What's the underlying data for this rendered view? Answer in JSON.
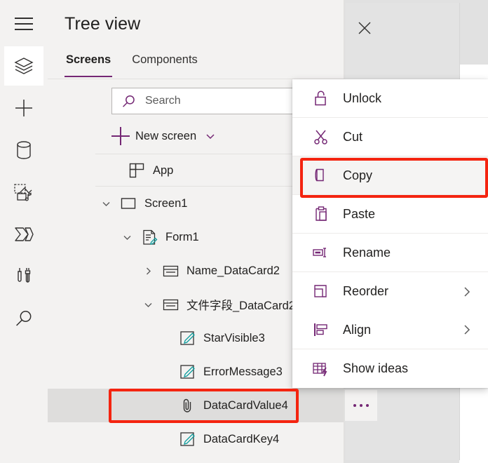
{
  "colors": {
    "accent_purple": "#742774",
    "annotation_red": "#f42410",
    "panel_bg": "#f3f2f1",
    "selected_row": "#dedddc",
    "canvas_bg": "#e1e1e1",
    "label_teal": "#0f9d9d"
  },
  "rail": {
    "items": [
      {
        "name": "hamburger-menu-icon",
        "selected": false
      },
      {
        "name": "tree-view-layers-icon",
        "selected": true
      },
      {
        "name": "insert-plus-icon",
        "selected": false
      },
      {
        "name": "data-cylinder-icon",
        "selected": false
      },
      {
        "name": "media-icon",
        "selected": false
      },
      {
        "name": "power-automate-icon",
        "selected": false
      },
      {
        "name": "variables-tools-icon",
        "selected": false
      },
      {
        "name": "search-rail-icon",
        "selected": false
      }
    ]
  },
  "panel": {
    "title": "Tree view",
    "close_label": "Close",
    "tabs": [
      {
        "label": "Screens",
        "active": true
      },
      {
        "label": "Components",
        "active": false
      }
    ],
    "search": {
      "placeholder": "Search",
      "value": ""
    },
    "new_screen": {
      "label": "New screen"
    },
    "tree": [
      {
        "label": "App",
        "indent": 0,
        "chevron": "none",
        "icon": "app-grid-icon",
        "selected": false
      },
      {
        "label": "Screen1",
        "indent": 0,
        "chevron": "down",
        "icon": "screen-rect-icon",
        "selected": false
      },
      {
        "label": "Form1",
        "indent": 1,
        "chevron": "down",
        "icon": "form-edit-icon",
        "selected": false
      },
      {
        "label": "Name_DataCard2",
        "indent": 2,
        "chevron": "right",
        "icon": "datacard-icon",
        "selected": false
      },
      {
        "label": "文件字段_DataCard2",
        "indent": 2,
        "chevron": "down",
        "icon": "datacard-icon",
        "selected": false
      },
      {
        "label": "StarVisible3",
        "indent": 3,
        "chevron": "none",
        "icon": "label-edit-icon",
        "selected": false
      },
      {
        "label": "ErrorMessage3",
        "indent": 3,
        "chevron": "none",
        "icon": "label-edit-icon",
        "selected": false
      },
      {
        "label": "DataCardValue4",
        "indent": 3,
        "chevron": "none",
        "icon": "attachment-paperclip-icon",
        "selected": true
      },
      {
        "label": "DataCardKey4",
        "indent": 3,
        "chevron": "none",
        "icon": "label-edit-icon",
        "selected": false
      }
    ],
    "more_options_label": "More options"
  },
  "context_menu": {
    "items": [
      {
        "label": "Unlock",
        "icon": "unlock-padlock-icon",
        "submenu": false,
        "highlighted": false
      },
      {
        "label": "Cut",
        "icon": "scissors-icon",
        "submenu": false,
        "highlighted": false
      },
      {
        "label": "Copy",
        "icon": "copy-pages-icon",
        "submenu": false,
        "highlighted": true
      },
      {
        "label": "Paste",
        "icon": "clipboard-paste-icon",
        "submenu": false,
        "highlighted": false
      },
      {
        "label": "Rename",
        "icon": "rename-icon",
        "submenu": false,
        "highlighted": false
      },
      {
        "label": "Reorder",
        "icon": "reorder-squares-icon",
        "submenu": true,
        "highlighted": false
      },
      {
        "label": "Align",
        "icon": "align-left-icon",
        "submenu": true,
        "highlighted": false
      },
      {
        "label": "Show ideas",
        "icon": "show-ideas-icon",
        "submenu": false,
        "highlighted": false
      }
    ]
  },
  "annotations": [
    {
      "name": "copy-highlight-box",
      "target": "Copy"
    },
    {
      "name": "datacardvalue4-highlight-box",
      "target": "DataCardValue4"
    }
  ]
}
